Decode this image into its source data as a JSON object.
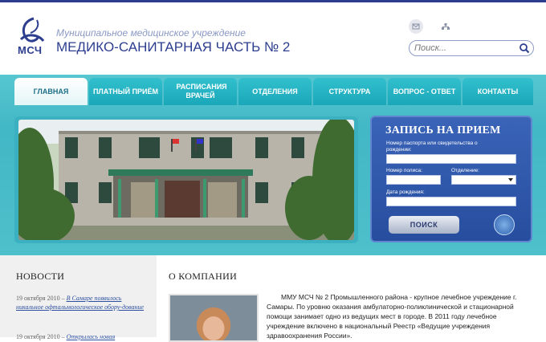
{
  "header": {
    "org_subtitle": "Муниципальное медицинское учреждение",
    "org_title": "МЕДИКО-САНИТАРНАЯ ЧАСТЬ № 2",
    "logo_text": "МСЧ",
    "search_placeholder": "Поиск..."
  },
  "nav": {
    "items": [
      {
        "label": "ГЛАВНАЯ"
      },
      {
        "label": "ПЛАТНЫЙ ПРИЁМ"
      },
      {
        "label": "РАСПИСАНИЯ ВРАЧЕЙ"
      },
      {
        "label": "ОТДЕЛЕНИЯ"
      },
      {
        "label": "СТРУКТУРА"
      },
      {
        "label": "ВОПРОС - ОТВЕТ"
      },
      {
        "label": "КОНТАКТЫ"
      }
    ]
  },
  "appointment": {
    "title": "ЗАПИСЬ НА ПРИЕМ",
    "passport_label": "Номер паспорта или свидетельства о рождении:",
    "policy_label": "Номер полиса:",
    "department_label": "Отделение:",
    "birthdate_label": "Дата рождения:",
    "submit_label": "ПОИСК"
  },
  "news": {
    "title": "НОВОСТИ",
    "items": [
      {
        "date": "19 октября 2010 –",
        "link": "В Самаре появилось никальное офтальмологическое обору-дование"
      },
      {
        "date": "19 октября 2010 –",
        "link": "Открылась новая"
      }
    ]
  },
  "about": {
    "title": "О КОМПАНИИ",
    "text": "ММУ МСЧ № 2 Промышленного района - крупное лечебное учреждение г. Самары. По уровню оказания амбулаторно-поликлинической и стационарной помощи занимает одно из ведущих мест в городе. В 2011 году лечебное учреждение включено в национальный Реестр «Ведущие учреждения здравоохранения России»."
  },
  "colors": {
    "brand_blue": "#2d3e8f",
    "teal": "#42b7c5",
    "form_blue": "#274d9e"
  }
}
